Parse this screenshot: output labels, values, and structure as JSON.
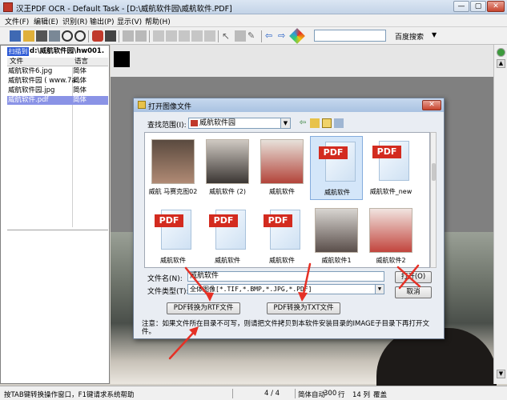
{
  "window": {
    "title": "汉王PDF OCR - Default Task - [D:\\威航软件园\\威航软件.PDF]",
    "minimize": "—",
    "maximize": "▢",
    "close": "✕"
  },
  "menu": [
    "文件(F)",
    "编辑(E)",
    "识别(R)",
    "输出(P)",
    "显示(V)",
    "帮助(H)"
  ],
  "toolbar": {
    "search_value": "",
    "search_engine": "百度搜索",
    "dropdown": "▼"
  },
  "left_panel": {
    "tab": "扫描到",
    "path": "d:\\威航软件园\\hw001.",
    "columns": [
      "文件",
      "语言"
    ],
    "rows": [
      {
        "file": "威航软件6.jpg",
        "lang": "简体"
      },
      {
        "file": "威航软件园 ( www.7a...",
        "lang": "简体"
      },
      {
        "file": "威航软件园.jpg",
        "lang": "简体"
      },
      {
        "file": "威航软件.pdf",
        "lang": "简体"
      }
    ],
    "selected_index": 3
  },
  "status": {
    "hint": "按TAB键转换操作窗口，F1键请求系统帮助",
    "page": "4 / 4",
    "f1": "简体",
    "f2": "自动",
    "f3": "300",
    "f4": "行",
    "f5": "14 列",
    "f6": "覆盖"
  },
  "dialog": {
    "title": "打开图像文件",
    "close": "✕",
    "look_in_label": "查找范围(I):",
    "look_in_value": "威航软件园",
    "items": [
      {
        "label": "威航 马赛克图02",
        "kind": "photo"
      },
      {
        "label": "威航软件 (2)",
        "kind": "photo"
      },
      {
        "label": "威航软件",
        "kind": "photo"
      },
      {
        "label": "威航软件",
        "kind": "pdf",
        "selected": true
      },
      {
        "label": "威航软件_new",
        "kind": "pdf"
      },
      {
        "label": "威航软件",
        "kind": "pdf"
      },
      {
        "label": "威航软件",
        "kind": "pdf"
      },
      {
        "label": "威航软件",
        "kind": "pdf"
      },
      {
        "label": "威航软件1",
        "kind": "photo"
      },
      {
        "label": "威航软件2",
        "kind": "photo"
      }
    ],
    "pdf_badge": "PDF",
    "filename_label": "文件名(N):",
    "filename_value": "威航软件",
    "filetype_label": "文件类型(T):",
    "filetype_value": "全体图像[*.TIF,*.BMP,*.JPG,*.PDF]",
    "open_button": "打开(O)",
    "cancel_button": "取消",
    "rtf_button": "PDF转换为RTF文件",
    "txt_button": "PDF转换为TXT文件",
    "notice": "注意：如果文件所在目录不可写，则请把文件拷贝到本软件安装目录的IMAGE子目录下再打开文件。"
  },
  "colors": {
    "accent_red": "#e53025",
    "selection": "#8a93e6"
  }
}
